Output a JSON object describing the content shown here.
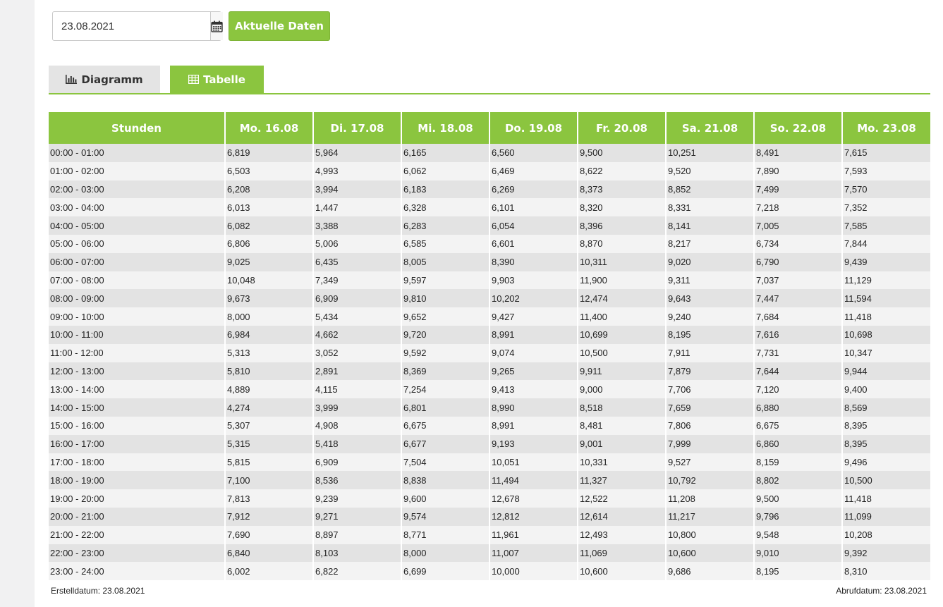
{
  "date_input": {
    "value": "23.08.2021"
  },
  "actions": {
    "current_data_label": "Aktuelle Daten"
  },
  "tabs": [
    {
      "label": "Diagramm",
      "icon": "bar-chart-icon",
      "active": false
    },
    {
      "label": "Tabelle",
      "icon": "table-icon",
      "active": true
    }
  ],
  "colors": {
    "accent": "#8bc53f",
    "row_dark": "#e3e3e3",
    "row_light": "#f3f3f3"
  },
  "table": {
    "headers": [
      "Stunden",
      "Mo. 16.08",
      "Di. 17.08",
      "Mi. 18.08",
      "Do. 19.08",
      "Fr. 20.08",
      "Sa. 21.08",
      "So. 22.08",
      "Mo. 23.08"
    ],
    "rows": [
      [
        "00:00 - 01:00",
        "6,819",
        "5,964",
        "6,165",
        "6,560",
        "9,500",
        "10,251",
        "8,491",
        "7,615"
      ],
      [
        "01:00 - 02:00",
        "6,503",
        "4,993",
        "6,062",
        "6,469",
        "8,622",
        "9,520",
        "7,890",
        "7,593"
      ],
      [
        "02:00 - 03:00",
        "6,208",
        "3,994",
        "6,183",
        "6,269",
        "8,373",
        "8,852",
        "7,499",
        "7,570"
      ],
      [
        "03:00 - 04:00",
        "6,013",
        "1,447",
        "6,328",
        "6,101",
        "8,320",
        "8,331",
        "7,218",
        "7,352"
      ],
      [
        "04:00 - 05:00",
        "6,082",
        "3,388",
        "6,283",
        "6,054",
        "8,396",
        "8,141",
        "7,005",
        "7,585"
      ],
      [
        "05:00 - 06:00",
        "6,806",
        "5,006",
        "6,585",
        "6,601",
        "8,870",
        "8,217",
        "6,734",
        "7,844"
      ],
      [
        "06:00 - 07:00",
        "9,025",
        "6,435",
        "8,005",
        "8,390",
        "10,311",
        "9,020",
        "6,790",
        "9,439"
      ],
      [
        "07:00 - 08:00",
        "10,048",
        "7,349",
        "9,597",
        "9,903",
        "11,900",
        "9,311",
        "7,037",
        "11,129"
      ],
      [
        "08:00 - 09:00",
        "9,673",
        "6,909",
        "9,810",
        "10,202",
        "12,474",
        "9,643",
        "7,447",
        "11,594"
      ],
      [
        "09:00 - 10:00",
        "8,000",
        "5,434",
        "9,652",
        "9,427",
        "11,400",
        "9,240",
        "7,684",
        "11,418"
      ],
      [
        "10:00 - 11:00",
        "6,984",
        "4,662",
        "9,720",
        "8,991",
        "10,699",
        "8,195",
        "7,616",
        "10,698"
      ],
      [
        "11:00 - 12:00",
        "5,313",
        "3,052",
        "9,592",
        "9,074",
        "10,500",
        "7,911",
        "7,731",
        "10,347"
      ],
      [
        "12:00 - 13:00",
        "5,810",
        "2,891",
        "8,369",
        "9,265",
        "9,911",
        "7,879",
        "7,644",
        "9,944"
      ],
      [
        "13:00 - 14:00",
        "4,889",
        "4,115",
        "7,254",
        "9,413",
        "9,000",
        "7,706",
        "7,120",
        "9,400"
      ],
      [
        "14:00 - 15:00",
        "4,274",
        "3,999",
        "6,801",
        "8,990",
        "8,518",
        "7,659",
        "6,880",
        "8,569"
      ],
      [
        "15:00 - 16:00",
        "5,307",
        "4,908",
        "6,675",
        "8,991",
        "8,481",
        "7,806",
        "6,675",
        "8,395"
      ],
      [
        "16:00 - 17:00",
        "5,315",
        "5,418",
        "6,677",
        "9,193",
        "9,001",
        "7,999",
        "6,860",
        "8,395"
      ],
      [
        "17:00 - 18:00",
        "5,815",
        "6,909",
        "7,504",
        "10,051",
        "10,331",
        "9,527",
        "8,159",
        "9,496"
      ],
      [
        "18:00 - 19:00",
        "7,100",
        "8,536",
        "8,838",
        "11,494",
        "11,327",
        "10,792",
        "8,802",
        "10,500"
      ],
      [
        "19:00 - 20:00",
        "7,813",
        "9,239",
        "9,600",
        "12,678",
        "12,522",
        "11,208",
        "9,500",
        "11,418"
      ],
      [
        "20:00 - 21:00",
        "7,912",
        "9,271",
        "9,574",
        "12,812",
        "12,614",
        "11,217",
        "9,796",
        "11,099"
      ],
      [
        "21:00 - 22:00",
        "7,690",
        "8,897",
        "8,771",
        "11,961",
        "12,493",
        "10,800",
        "9,548",
        "10,208"
      ],
      [
        "22:00 - 23:00",
        "6,840",
        "8,103",
        "8,000",
        "11,007",
        "11,069",
        "10,600",
        "9,010",
        "9,392"
      ],
      [
        "23:00 - 24:00",
        "6,002",
        "6,822",
        "6,699",
        "10,000",
        "10,600",
        "9,686",
        "8,195",
        "8,310"
      ]
    ]
  },
  "footer": {
    "created": "Erstelldatum: 23.08.2021",
    "retrieved": "Abrufdatum: 23.08.2021"
  }
}
